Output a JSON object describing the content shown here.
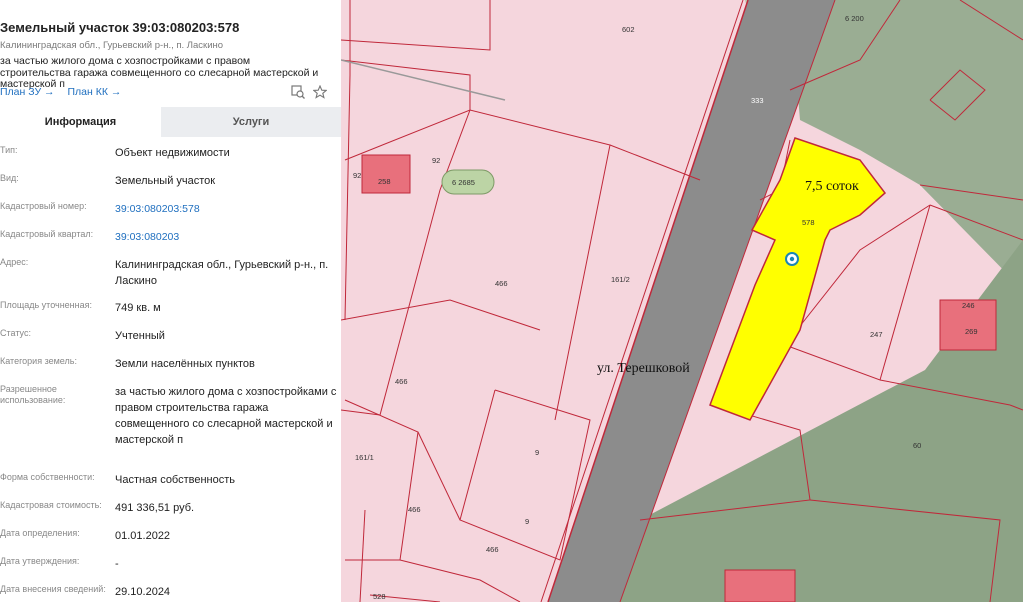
{
  "panel": {
    "title": "Земельный участок 39:03:080203:578",
    "address": "Калининградская обл., Гурьевский р-н., п. Ласкино",
    "description": "за частью жилого дома с хозпостройками с правом строительства гаража совмещенного со слесарной мастерской и мастерской п",
    "links": {
      "plan_zu": "План ЗУ →",
      "plan_kk": "План КК →"
    },
    "icons": [
      "map-search-icon",
      "star-icon"
    ],
    "tabs": {
      "info": "Информация",
      "services": "Услуги"
    },
    "rows": [
      {
        "label": "Тип:",
        "value": "Объект недвижимости"
      },
      {
        "label": "Вид:",
        "value": "Земельный участок"
      },
      {
        "label": "Кадастровый номер:",
        "value": "39:03:080203:578",
        "link": true
      },
      {
        "label": "Кадастровый квартал:",
        "value": "39:03:080203",
        "link": true
      },
      {
        "label": "Адрес:",
        "value": "Калининградская обл., Гурьевский р-н., п. Ласкино"
      },
      {
        "label": "Площадь уточненная:",
        "value": "749 кв. м"
      },
      {
        "label": "Статус:",
        "value": "Учтенный"
      },
      {
        "label": "Категория земель:",
        "value": "Земли населённых пунктов"
      },
      {
        "label": "Разрешенное использование:",
        "value": "за частью жилого дома с хозпостройками с правом строительства гаража совмещенного со слесарной мастерской и мастерской п"
      },
      {
        "label": "Форма собственности:",
        "value": "Частная собственность"
      },
      {
        "label": "Кадастровая стоимость:",
        "value": "491 336,51 руб."
      },
      {
        "label": "Дата определения:",
        "value": "01.01.2022"
      },
      {
        "label": "Дата утверждения:",
        "value": "-"
      },
      {
        "label": "Дата внесения сведений:",
        "value": "29.10.2024"
      }
    ]
  },
  "map": {
    "plot_area_label": "7,5 соток",
    "street_label": "ул. Терешковой",
    "parcel_labels": {
      "p602": "602",
      "p92a": "92",
      "p92b": "92",
      "p258": "258",
      "p2685": "6 2685",
      "p466a": "466",
      "p466b": "466",
      "p466c": "466",
      "p466d": "466",
      "p161_2": "161/2",
      "p161_1": "161/1",
      "p9a": "9",
      "p9b": "9",
      "p333": "333",
      "p578": "578",
      "p247": "247",
      "p246": "246",
      "p269": "269",
      "p60": "60",
      "p6200": "6 200",
      "p528": "528"
    },
    "colors": {
      "parcel_fill": "#f5d6dd",
      "parcel_border": "#c0283a",
      "building_fill": "#e8707c",
      "green_zone": "#8fa68a",
      "road": "#8c8c8c",
      "selected_plot": "#ffff00"
    }
  }
}
